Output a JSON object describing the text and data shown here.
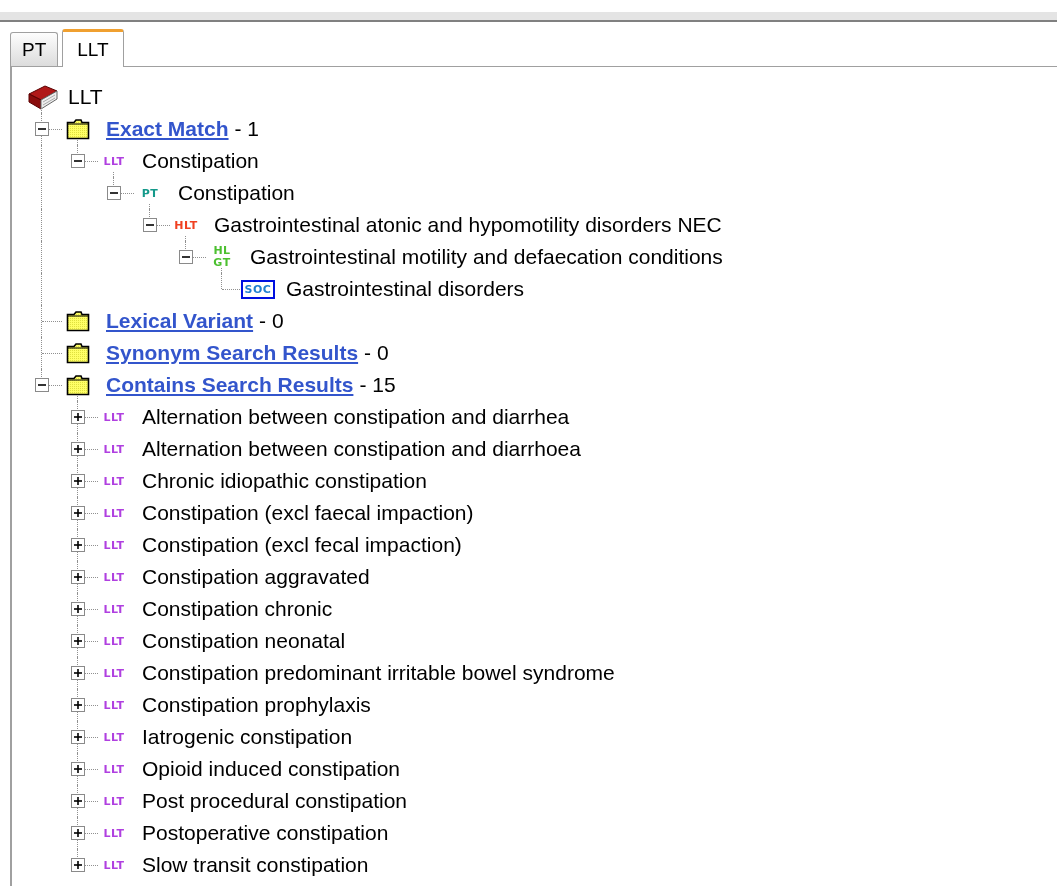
{
  "tabs": [
    {
      "label": "PT",
      "selected": false
    },
    {
      "label": "LLT",
      "selected": true
    }
  ],
  "tree": {
    "kind": "root",
    "label": "LLT",
    "children": [
      {
        "kind": "folder",
        "label": "Exact Match",
        "count": "- 1",
        "expanded": true,
        "selected": false,
        "children": [
          {
            "kind": "term",
            "color": "#b040e0",
            "badge": "LLT",
            "label": "Constipation",
            "expanded": true,
            "selected": false,
            "children": [
              {
                "kind": "term",
                "color": "#14998a",
                "badge": "PT",
                "label": "Constipation",
                "expanded": true,
                "selected": false,
                "children": [
                  {
                    "kind": "term",
                    "color": "#f04020",
                    "badge": "HLT",
                    "label": "Gastrointestinal atonic and hypomotility disorders NEC",
                    "expanded": true,
                    "selected": false,
                    "children": [
                      {
                        "kind": "term",
                        "color": "#4cc030",
                        "stacked": true,
                        "badge": "HLGT",
                        "label": "Gastrointestinal motility and defaecation conditions",
                        "expanded": true,
                        "selected": false,
                        "children": [
                          {
                            "kind": "term",
                            "color": "#1f7fd0",
                            "badge": "SOC",
                            "label": "Gastrointestinal disorders",
                            "selected": true
                          }
                        ]
                      }
                    ]
                  }
                ]
              }
            ]
          }
        ]
      },
      {
        "kind": "folder",
        "label": "Lexical Variant",
        "count": "- 0",
        "selected": false
      },
      {
        "kind": "folder",
        "label": "Synonym Search Results",
        "count": "- 0",
        "selected": false
      },
      {
        "kind": "folder",
        "label": "Contains Search Results",
        "count": "- 15",
        "expanded": true,
        "selected": false,
        "children": [
          {
            "kind": "term",
            "color": "#b040e0",
            "badge": "LLT",
            "label": "Alternation between constipation and diarrhea",
            "expanded": false,
            "selected": false
          },
          {
            "kind": "term",
            "color": "#b040e0",
            "badge": "LLT",
            "label": "Alternation between constipation and diarrhoea",
            "expanded": false,
            "selected": false
          },
          {
            "kind": "term",
            "color": "#b040e0",
            "badge": "LLT",
            "label": "Chronic idiopathic constipation",
            "expanded": false,
            "selected": false
          },
          {
            "kind": "term",
            "color": "#b040e0",
            "badge": "LLT",
            "label": "Constipation (excl faecal impaction)",
            "expanded": false,
            "selected": false
          },
          {
            "kind": "term",
            "color": "#b040e0",
            "badge": "LLT",
            "label": "Constipation (excl fecal impaction)",
            "expanded": false,
            "selected": false
          },
          {
            "kind": "term",
            "color": "#b040e0",
            "badge": "LLT",
            "label": "Constipation aggravated",
            "expanded": false,
            "selected": false
          },
          {
            "kind": "term",
            "color": "#b040e0",
            "badge": "LLT",
            "label": "Constipation chronic",
            "expanded": false,
            "selected": false
          },
          {
            "kind": "term",
            "color": "#b040e0",
            "badge": "LLT",
            "label": "Constipation neonatal",
            "expanded": false,
            "selected": false
          },
          {
            "kind": "term",
            "color": "#b040e0",
            "badge": "LLT",
            "label": "Constipation predominant irritable bowel syndrome",
            "expanded": false,
            "selected": false
          },
          {
            "kind": "term",
            "color": "#b040e0",
            "badge": "LLT",
            "label": "Constipation prophylaxis",
            "expanded": false,
            "selected": false
          },
          {
            "kind": "term",
            "color": "#b040e0",
            "badge": "LLT",
            "label": "Iatrogenic constipation",
            "expanded": false,
            "selected": false
          },
          {
            "kind": "term",
            "color": "#b040e0",
            "badge": "LLT",
            "label": "Opioid induced constipation",
            "expanded": false,
            "selected": false
          },
          {
            "kind": "term",
            "color": "#b040e0",
            "badge": "LLT",
            "label": "Post procedural constipation",
            "expanded": false,
            "selected": false
          },
          {
            "kind": "term",
            "color": "#b040e0",
            "badge": "LLT",
            "label": "Postoperative constipation",
            "expanded": false,
            "selected": false
          },
          {
            "kind": "term",
            "color": "#b040e0",
            "badge": "LLT",
            "label": "Slow transit constipation",
            "expanded": false,
            "selected": false
          }
        ]
      }
    ]
  }
}
